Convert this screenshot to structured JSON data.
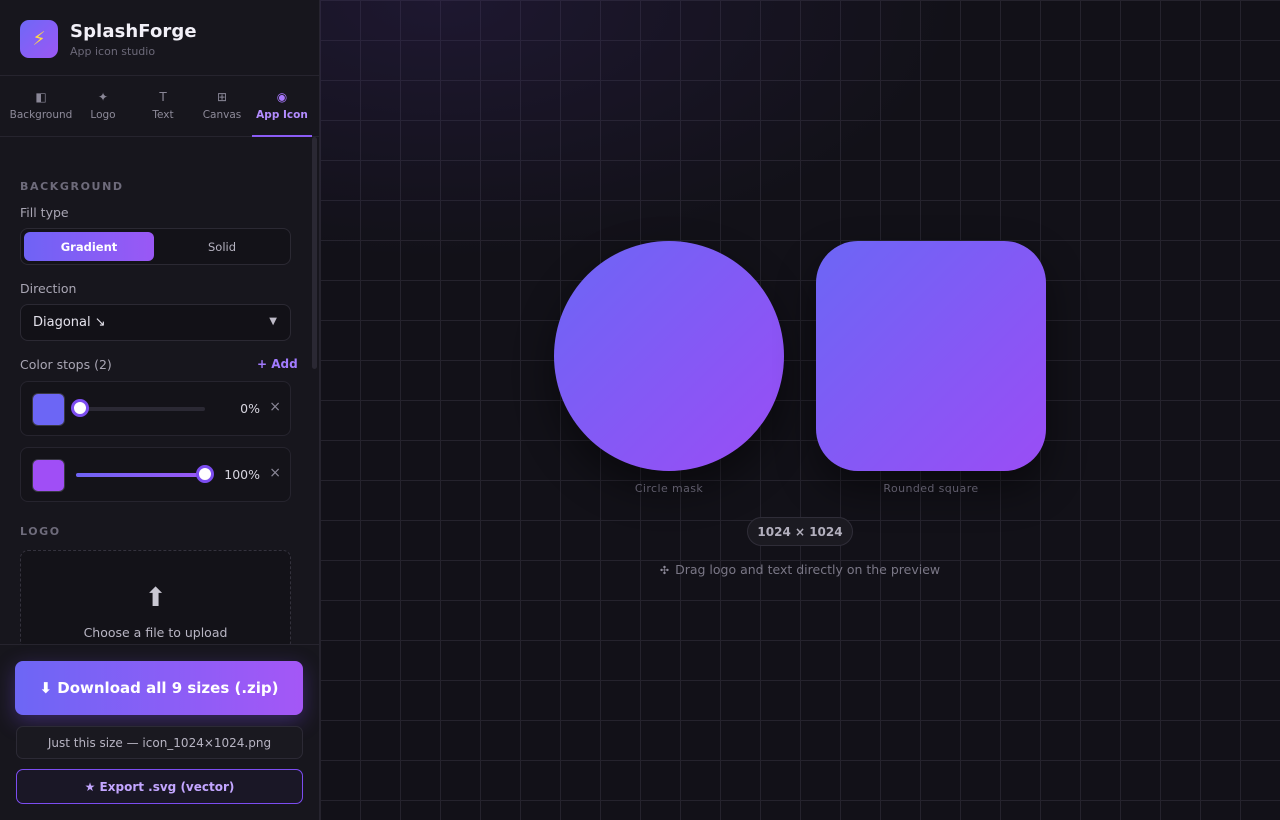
{
  "app": {
    "name": "SplashForge",
    "subtitle": "App icon studio",
    "logo_icon": "lightning-icon",
    "logo_glyph": "⚡"
  },
  "tabs": [
    {
      "label": "Background",
      "icon": "half-square-icon",
      "glyph": "◧"
    },
    {
      "label": "Logo",
      "icon": "sparkle-icon",
      "glyph": "✦"
    },
    {
      "label": "Text",
      "icon": "text-t-icon",
      "glyph": "T"
    },
    {
      "label": "Canvas",
      "icon": "grid-icon",
      "glyph": "⊞"
    },
    {
      "label": "App Icon",
      "icon": "target-icon",
      "glyph": "◉",
      "active": true
    }
  ],
  "background": {
    "section_title": "BACKGROUND",
    "fill_type_label": "Fill type",
    "fill_options": [
      "Gradient",
      "Solid"
    ],
    "fill_selected": "Gradient",
    "direction_label": "Direction",
    "direction_value": "Diagonal ↘",
    "color_stops_label": "Color stops (2)",
    "add_label": "+ Add",
    "stops": [
      {
        "color": "#6c66f5",
        "position": "0%",
        "remove_glyph": "×"
      },
      {
        "color": "#a04ef6",
        "position": "100%",
        "remove_glyph": "×"
      }
    ]
  },
  "logo": {
    "section_title": "LOGO",
    "upload_glyph": "⬆",
    "upload_text": "Choose a file to upload"
  },
  "actions": {
    "download_all": "⬇ Download all 9 sizes (.zip)",
    "download_single": "Just this size — icon_1024×1024.png",
    "export_svg": "★ Export .svg (vector)"
  },
  "preview": {
    "circle_label": "Circle mask",
    "square_label": "Rounded square",
    "size": "1024 × 1024",
    "hint_glyph": "✣",
    "hint": "Drag logo and text directly on the preview",
    "gradient_start": "#6c66f5",
    "gradient_end": "#9a4df5"
  }
}
